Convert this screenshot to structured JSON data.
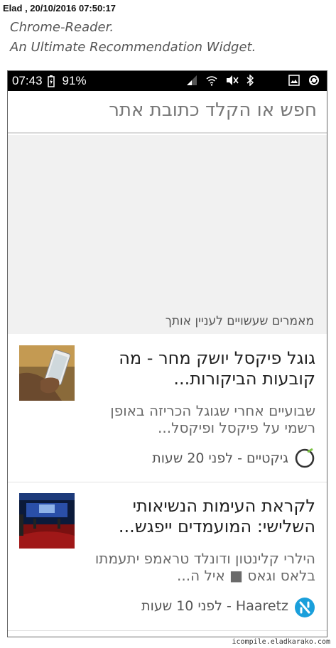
{
  "post": {
    "meta": "Elad , 20/10/2016 07:50:17",
    "caption_line1": "Chrome-Reader.",
    "caption_line2": "An Ultimate Recommendation Widget."
  },
  "status_bar": {
    "time": "07:43",
    "battery": "91%",
    "icons": [
      "battery-charging-icon",
      "signal-icon",
      "wifi-icon",
      "mute-icon",
      "bluetooth-icon",
      "image-notification-icon",
      "sync-notification-icon"
    ]
  },
  "search": {
    "placeholder": "חפש או הקלד כתובת אתר"
  },
  "recommendations": {
    "section_title": "מאמרים שעשויים לעניין אותך",
    "articles": [
      {
        "title": "גוגל פיקסל יושק מחר - מה קובעות הביקורות...",
        "description": "שבועיים אחרי שגוגל הכריזה באופן רשמי על פיקסל ופיקסל...",
        "source": "גיקטיים - לפני 20 שעות",
        "logo_icon": "geektime-logo-icon",
        "thumb_icon": "hand-holding-phone-image"
      },
      {
        "title": "לקראת העימות הנשיאותי השלישי: המועמדים ייפגש...",
        "description": "הילרי קלינטון ודונלד טראמפ יתעמתו בלאס וגאס ■ איל ה...",
        "source": "Haaretz - לפני 10 שעות",
        "logo_icon": "haaretz-logo-icon",
        "thumb_icon": "debate-stage-image"
      }
    ]
  },
  "footer": {
    "watermark": "icompile.eladkarako.com"
  },
  "colors": {
    "status_bar_bg": "#000000",
    "search_border": "#dadada",
    "banner_bg": "#f1f1f1",
    "geektime_green": "#7ac142",
    "haaretz_blue": "#1a9fdb"
  }
}
